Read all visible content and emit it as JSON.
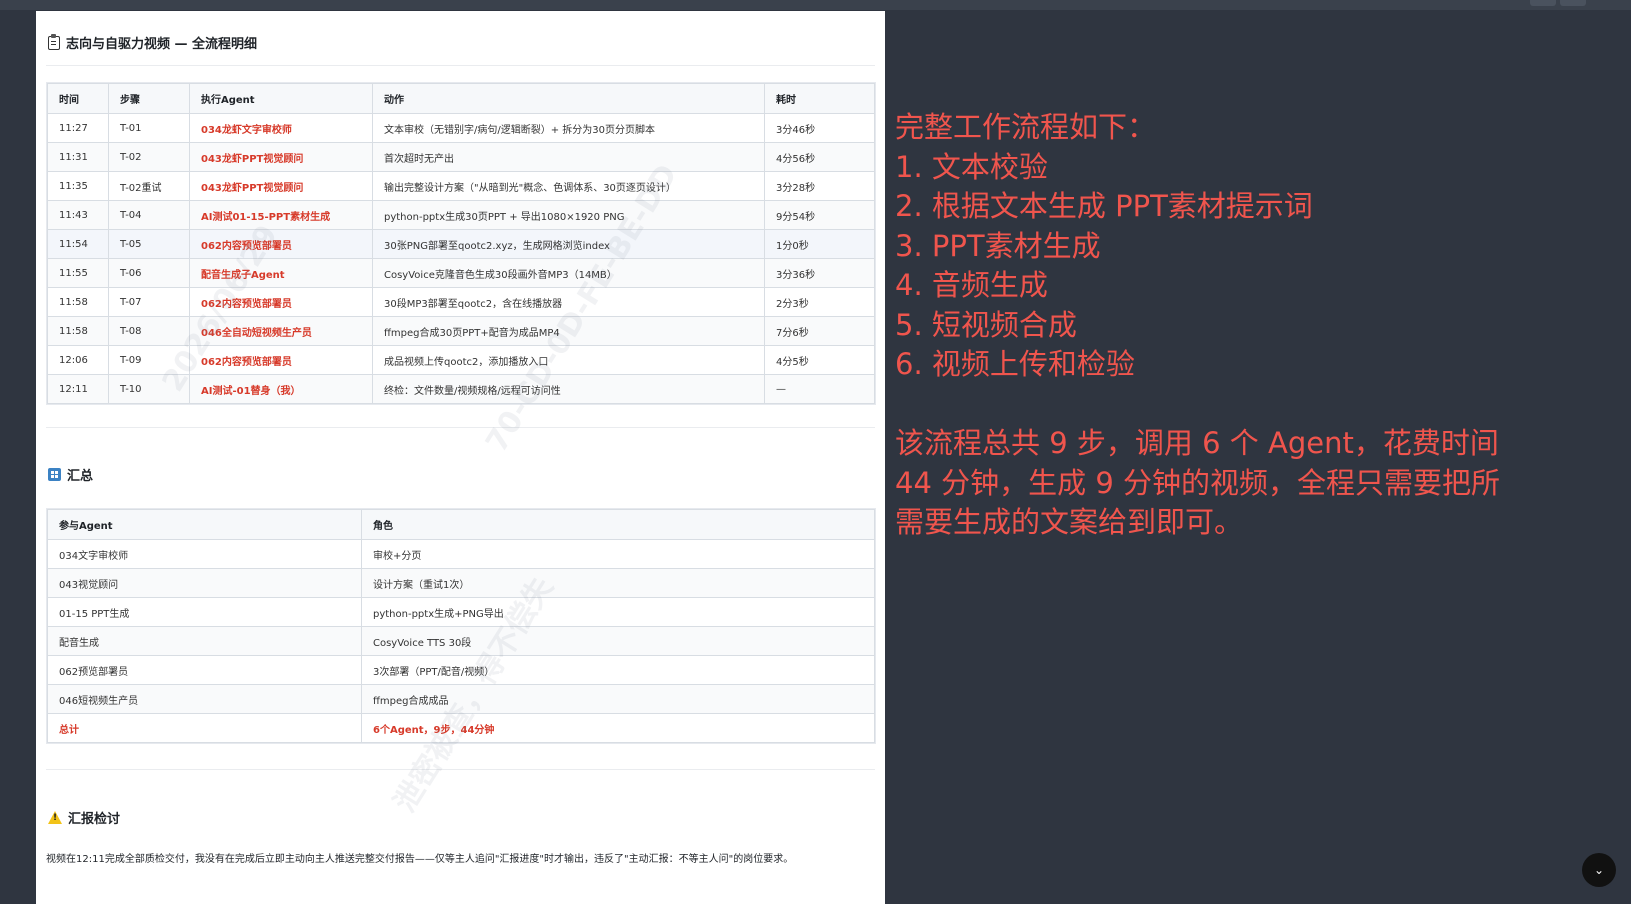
{
  "page": {
    "title": "志向与自驱力视频 — 全流程明细",
    "summary_title": "汇总",
    "report_title": "汇报检讨",
    "report_text": "视频在12:11完成全部质检交付，我没有在完成后立即主动向主人推送完整交付报告——仅等主人追问\"汇报进度\"时才输出，违反了\"主动汇报：不等主人问\"的岗位要求。"
  },
  "flow_table": {
    "headers": [
      "时间",
      "步骤",
      "执行Agent",
      "动作",
      "耗时"
    ],
    "rows": [
      {
        "time": "11:27",
        "step": "T-01",
        "agent": "034龙虾文字审校师",
        "action": "文本审校（无错别字/病句/逻辑断裂）+ 拆分为30页分页脚本",
        "duration": "3分46秒"
      },
      {
        "time": "11:31",
        "step": "T-02",
        "agent": "043龙虾PPT视觉顾问",
        "action": "首次超时无产出",
        "duration": "4分56秒"
      },
      {
        "time": "11:35",
        "step": "T-02重试",
        "agent": "043龙虾PPT视觉顾问",
        "action": "输出完整设计方案（\"从暗到光\"概念、色调体系、30页逐页设计）",
        "duration": "3分28秒"
      },
      {
        "time": "11:43",
        "step": "T-04",
        "agent": "AI测试01-15-PPT素材生成",
        "action": "python-pptx生成30页PPT + 导出1080×1920 PNG",
        "duration": "9分54秒"
      },
      {
        "time": "11:54",
        "step": "T-05",
        "agent": "062内容预览部署员",
        "action": "30张PNG部署至qootc2.xyz，生成网格浏览index",
        "duration": "1分0秒"
      },
      {
        "time": "11:55",
        "step": "T-06",
        "agent": "配音生成子Agent",
        "action": "CosyVoice克隆音色生成30段画外音MP3（14MB）",
        "duration": "3分36秒"
      },
      {
        "time": "11:58",
        "step": "T-07",
        "agent": "062内容预览部署员",
        "action": "30段MP3部署至qootc2，含在线播放器",
        "duration": "2分3秒"
      },
      {
        "time": "11:58",
        "step": "T-08",
        "agent": "046全自动短视频生产员",
        "action": "ffmpeg合成30页PPT+配音为成品MP4",
        "duration": "7分6秒"
      },
      {
        "time": "12:06",
        "step": "T-09",
        "agent": "062内容预览部署员",
        "action": "成品视频上传qootc2，添加播放入口",
        "duration": "4分5秒"
      },
      {
        "time": "12:11",
        "step": "T-10",
        "agent": "AI测试-01替身（我）",
        "action": "终检：文件数量/视频规格/远程可访问性",
        "duration": "—"
      }
    ]
  },
  "summary_table": {
    "headers": [
      "参与Agent",
      "角色"
    ],
    "rows": [
      {
        "agent": "034文字审校师",
        "role": "审校+分页"
      },
      {
        "agent": "043视觉顾问",
        "role": "设计方案（重试1次）"
      },
      {
        "agent": "01-15 PPT生成",
        "role": "python-pptx生成+PNG导出"
      },
      {
        "agent": "配音生成",
        "role": "CosyVoice TTS 30段"
      },
      {
        "agent": "062预览部署员",
        "role": "3次部署（PPT/配音/视频）"
      },
      {
        "agent": "046短视频生产员",
        "role": "ffmpeg合成成品"
      }
    ],
    "total": {
      "agent": "总计",
      "role": "6个Agent，9步，44分钟"
    }
  },
  "side_note": {
    "lines": [
      "完整工作流程如下：",
      "1. 文本校验",
      "2. 根据文本生成 PPT素材提示词",
      "3. PPT素材生成",
      "4. 音频生成",
      "5. 短视频合成",
      "6. 视频上传和检验"
    ],
    "paragraph": [
      "该流程总共 9 步，调用 6 个 Agent，花费时间",
      "44 分钟，生成 9 分钟的视频，全程只需要把所",
      "需要生成的文案给到即可。"
    ]
  },
  "watermark": {
    "lines": [
      "2026/06/29",
      "70-CD-0D-FE-BE-DD",
      "泄密被查，得不偿失"
    ]
  },
  "colors": {
    "accent_red": "#d73a2a",
    "note_red": "#f0554d",
    "background": "#2f3540"
  },
  "icons": {
    "title": "clipboard-icon",
    "summary": "grid-icon",
    "report": "warning-icon",
    "scroll": "chevron-down-icon"
  }
}
